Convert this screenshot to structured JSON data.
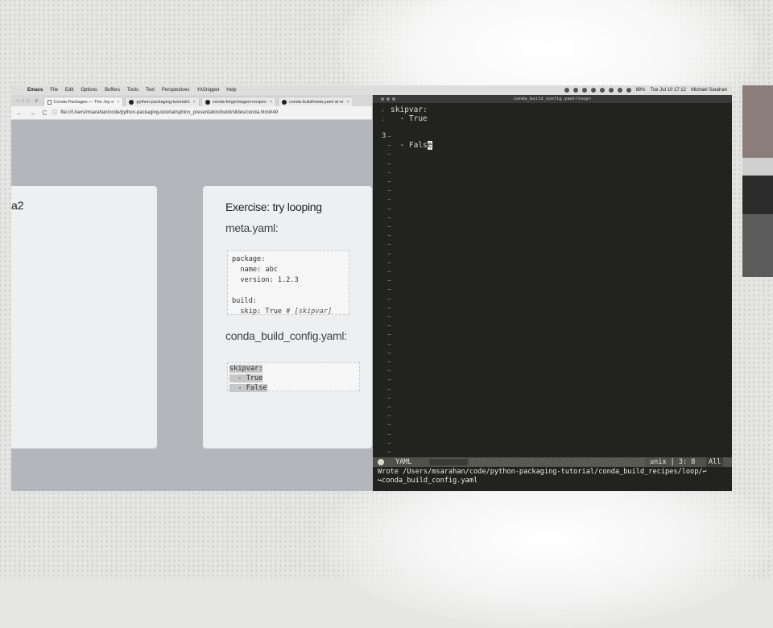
{
  "menubar": {
    "app": "Emacs",
    "items": [
      "File",
      "Edit",
      "Options",
      "Buffers",
      "Tools",
      "Text",
      "Perspectives",
      "YASnippet",
      "Help"
    ],
    "battery": "88%",
    "clock": "Tue Jul 10 17:12",
    "user": "Michael Sarahan"
  },
  "browser": {
    "tabs": [
      {
        "label": "Conda Packages — The Joy o"
      },
      {
        "label": "python-packaging-tutorial/s"
      },
      {
        "label": "conda-forge/staged-recipes"
      },
      {
        "label": "conda-build/meta.yaml at m"
      }
    ],
    "url": "file:///Users/msarahan/code/python-packaging-tutorial/sphinx_presentation/build/slides/conda.html#49",
    "left_slide_fragment": "a2",
    "slide": {
      "title": "Exercise: try looping",
      "meta_heading": "meta.yaml:",
      "meta_code": [
        "package:",
        "  name: abc",
        "  version: 1.2.3",
        "",
        "build:",
        "  skip: True "
      ],
      "meta_comment": "# [skipvar]",
      "config_heading": "conda_build_config.yaml:",
      "config_code": [
        "skipvar:",
        "  - True",
        "  - False"
      ]
    }
  },
  "emacs": {
    "title": "conda_build_config.yaml<loop>",
    "lines": [
      {
        "num": "",
        "text": "skipvar:"
      },
      {
        "num": "",
        "text": "  - True"
      },
      {
        "num": "3",
        "text": "  - Fals",
        "cursor_char": "e"
      }
    ],
    "empty_marker": "~",
    "modeline": {
      "mode": "YAML",
      "eol": "unix",
      "position": "3: 8",
      "scroll": "All"
    },
    "minibuffer": [
      "Wrote /Users/msarahan/code/python-packaging-tutorial/conda_build_recipes/loop/↩",
      "↪conda_build_config.yaml"
    ]
  }
}
